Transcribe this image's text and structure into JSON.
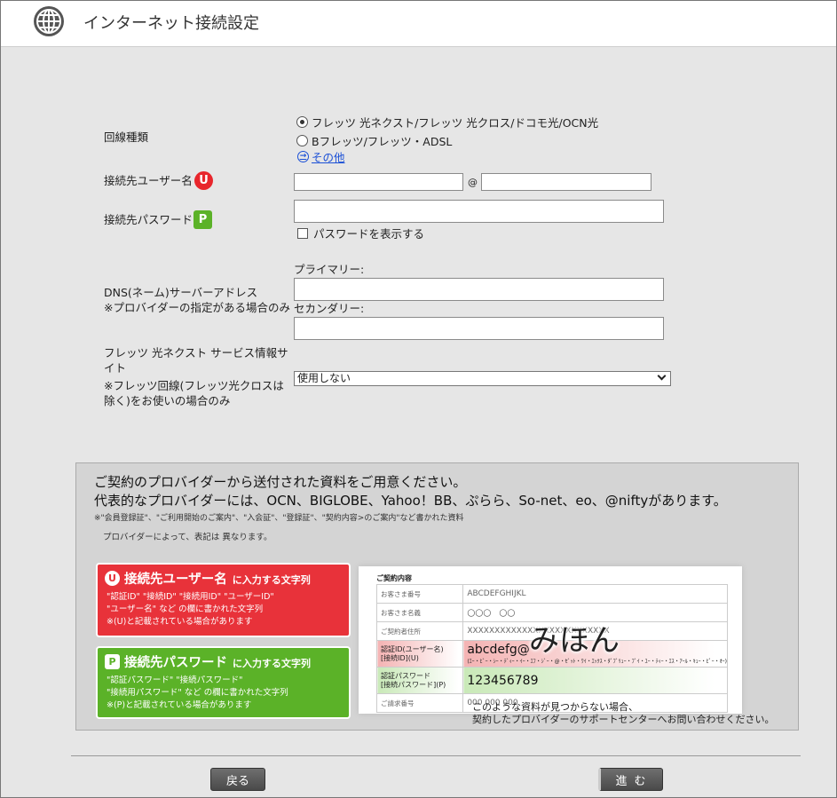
{
  "header": {
    "title": "インターネット接続設定",
    "icon": "globe-icon"
  },
  "line_type": {
    "label": "回線種類",
    "options": [
      {
        "label": "フレッツ 光ネクスト/フレッツ 光クロス/ドコモ光/OCN光",
        "selected": true
      },
      {
        "label": "Bフレッツ/フレッツ・ADSL",
        "selected": false
      }
    ],
    "other_link": "その他"
  },
  "username": {
    "label": "接続先ユーザー名",
    "badge": "U",
    "at": "@",
    "value_user": "",
    "value_domain": ""
  },
  "password": {
    "label": "接続先パスワード",
    "badge": "P",
    "value": "",
    "show_label": "パスワードを表示する",
    "show_checked": false
  },
  "dns": {
    "label": "DNS(ネーム)サーバーアドレス",
    "note": "※プロバイダーの指定がある場合のみ",
    "primary_label": "プライマリー:",
    "secondary_label": "セカンダリー:",
    "primary_value": "",
    "secondary_value": ""
  },
  "flets_site": {
    "label1": "フレッツ 光ネクスト サービス情報サ",
    "label2": "イト",
    "note1": "※フレッツ回線(フレッツ光クロスは",
    "note2": "除く)をお使いの場合のみ",
    "selected": "使用しない"
  },
  "info": {
    "line1": "ご契約のプロバイダーから送付された資料をご用意ください。",
    "line2": "代表的なプロバイダーには、OCN、BIGLOBE、Yahoo！BB、ぷらら、So-net、eo、@niftyがあります。",
    "small1": "※\"会員登録証\"、\"ご利用開始のご案内\"、\"入会証\"、\"登録証\"、\"契約内容>のご案内\"など書かれた資料",
    "small2": "プロバイダーによって、表記は 異なります。",
    "user_card": {
      "badge": "U",
      "head": "接続先ユーザー名",
      "sub": "に入力する文字列",
      "lines": [
        "\"認証ID\" \"接続ID\" \"接続用ID\" \"ユーザーID\"",
        "\"ユーザー名\" など の欄に書かれた文字列",
        "※(U)と記載されている場合があります"
      ]
    },
    "pass_card": {
      "badge": "P",
      "head": "接続先パスワード",
      "sub": "に入力する文字列",
      "lines": [
        "\"認証パスワード\" \"接続パスワード\"",
        "\"接続用パスワード\" など の欄に書かれた文字列",
        "※(P)と記載されている場合があります"
      ]
    },
    "doc": {
      "title": "ご契約内容",
      "rows": [
        {
          "key": "お客さま番号",
          "value": "ABCDEFGHIJKL"
        },
        {
          "key": "お客さま名義",
          "value": "〇〇〇　〇〇"
        },
        {
          "key": "ご契約者住所",
          "value": "XXXXXXXXXXXXXXXXXXXXXXXXXX"
        }
      ],
      "auth_id_key1": "認証ID(ユーザー名)",
      "auth_id_key2": "[接続ID](U)",
      "auth_id_value": "abcdefg@",
      "auth_id_fine": "(ｴｰ・ﾋﾞｰ・ｼｰ・ﾃﾞｨｰ・ｲｰ・ｴﾌ・ｼﾞｰ・@・ｾﾞｯﾄ・ﾜｲ・ｴｯｸｽ・ﾀﾞﾌﾞﾘｭｰ・ﾌﾞｲ・ﾕｰ・ﾃｨｰ・ｴｽ・ｱｰﾙ・ｷｭｰ・ﾋﾟｰ・ｵｰ)",
      "auth_pw_key1": "認証パスワード",
      "auth_pw_key2": "[接続パスワード](P)",
      "auth_pw_value": "123456789",
      "last_key": "ご請求番号",
      "last_value": "000 000 000",
      "watermark": "みほん"
    },
    "note1": "このような資料が見つからない場合、",
    "note2": "契約したプロバイダーのサポートセンターへお問い合わせください。"
  },
  "buttons": {
    "back": "戻る",
    "next": "進む"
  }
}
